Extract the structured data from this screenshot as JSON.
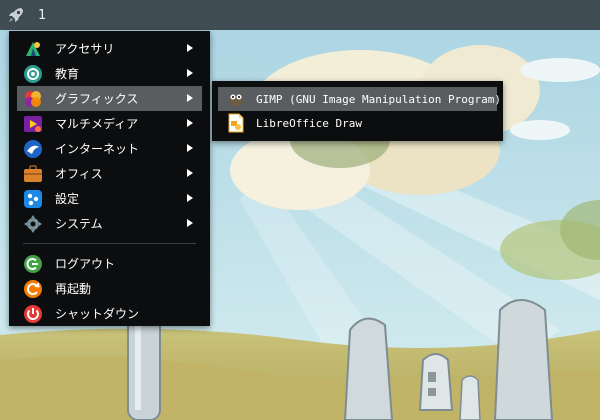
{
  "taskbar": {
    "launcher_icon": "rocket-icon",
    "workspace_number": "1"
  },
  "menu": {
    "categories": [
      {
        "label": "アクセサリ",
        "icon": "accessories-icon"
      },
      {
        "label": "教育",
        "icon": "education-icon"
      },
      {
        "label": "グラフィックス",
        "icon": "graphics-icon"
      },
      {
        "label": "マルチメディア",
        "icon": "multimedia-icon"
      },
      {
        "label": "インターネット",
        "icon": "internet-icon"
      },
      {
        "label": "オフィス",
        "icon": "office-icon"
      },
      {
        "label": "設定",
        "icon": "settings-icon"
      },
      {
        "label": "システム",
        "icon": "system-icon"
      }
    ],
    "actions": [
      {
        "label": "ログアウト",
        "icon": "logout-icon"
      },
      {
        "label": "再起動",
        "icon": "restart-icon"
      },
      {
        "label": "シャットダウン",
        "icon": "shutdown-icon"
      }
    ]
  },
  "submenu": {
    "items": [
      {
        "label": "GIMP (GNU Image Manipulation Program)",
        "icon": "gimp-icon"
      },
      {
        "label": "LibreOffice Draw",
        "icon": "libreoffice-draw-icon"
      }
    ]
  },
  "colors": {
    "menu_bg": "#0c0d0e",
    "highlight": "#5a5d5f",
    "taskbar_bg": "#282e34"
  }
}
